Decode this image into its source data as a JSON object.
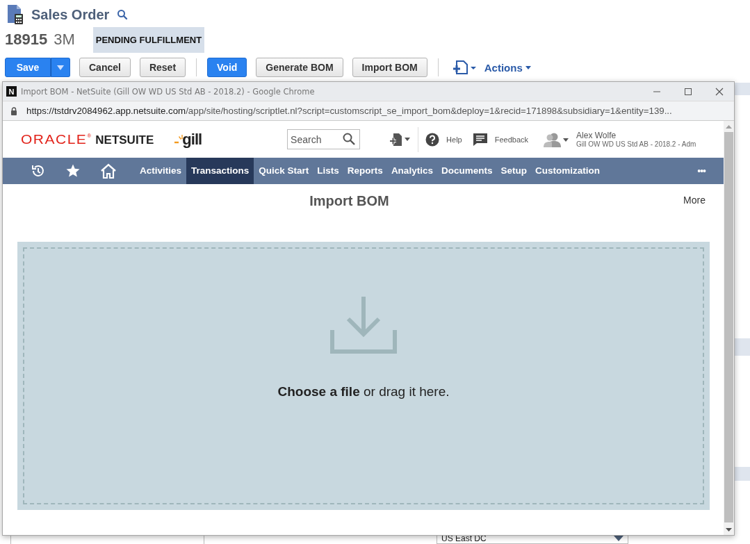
{
  "record": {
    "title": "Sales Order",
    "number": "18915",
    "customer": "3M",
    "status": "PENDING FULFILLMENT"
  },
  "toolbar": [
    {
      "kind": "split",
      "label": "Save"
    },
    {
      "kind": "default",
      "label": "Cancel"
    },
    {
      "kind": "default",
      "label": "Reset"
    },
    {
      "kind": "divider"
    },
    {
      "kind": "primary",
      "label": "Void"
    },
    {
      "kind": "default",
      "label": "Generate BOM"
    },
    {
      "kind": "default",
      "label": "Import BOM"
    },
    {
      "kind": "divider"
    },
    {
      "kind": "new-record"
    },
    {
      "kind": "menu",
      "label": "Actions"
    }
  ],
  "background": {
    "location_value": "US East DC"
  },
  "popup": {
    "favicon": "N",
    "window_title": "Import BOM - NetSuite (Gill OW WD US Std AB - 2018.2) - Google Chrome",
    "url_host": "https://tstdrv2084962.app.netsuite.com",
    "url_path": "/app/site/hosting/scriptlet.nl?script=customscript_se_import_bom&deploy=1&recid=171898&subsidiary=1&entity=139...",
    "brand": "ORACLE",
    "brand_mark": "®",
    "product": "NETSUITE",
    "company_logo": "gill",
    "search": {
      "placeholder": "Search"
    },
    "help": "Help",
    "feedback": "Feedback",
    "user_name": "Alex Wolfe",
    "user_role": "Gill OW WD US Std AB - 2018.2 - Adm",
    "nav": [
      {
        "kind": "recent"
      },
      {
        "kind": "star"
      },
      {
        "kind": "home"
      },
      {
        "kind": "text",
        "label": "Activities",
        "selected": false
      },
      {
        "kind": "text",
        "label": "Transactions",
        "selected": true
      },
      {
        "kind": "text",
        "label": "Quick Start",
        "selected": false
      },
      {
        "kind": "text",
        "label": "Lists",
        "selected": false
      },
      {
        "kind": "text",
        "label": "Reports",
        "selected": false
      },
      {
        "kind": "text",
        "label": "Analytics",
        "selected": false
      },
      {
        "kind": "text",
        "label": "Documents",
        "selected": false
      },
      {
        "kind": "text",
        "label": "Setup",
        "selected": false
      },
      {
        "kind": "text",
        "label": "Customization",
        "selected": false
      }
    ],
    "nav_more": "•••",
    "page_title": "Import BOM",
    "more": "More",
    "drop_text": "**Choose a file** or drag it here."
  }
}
